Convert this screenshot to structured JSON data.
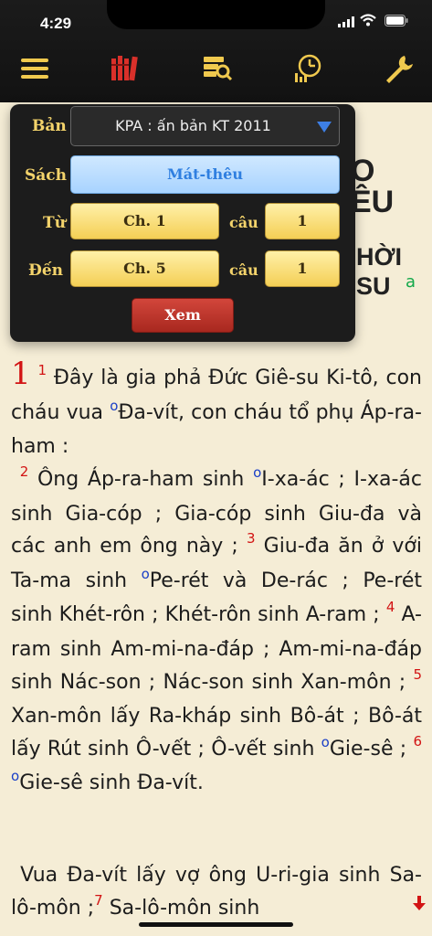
{
  "status": {
    "time": "4:29"
  },
  "toolbar": {
    "icons": [
      "menu-icon",
      "library-icon",
      "search-books-icon",
      "history-icon",
      "wrench-icon"
    ]
  },
  "background_title": {
    "line1": "O",
    "line2": "ÊU",
    "line3": "HỜI",
    "line4": "SU",
    "note": "a"
  },
  "popup": {
    "edition_label": "Bản",
    "edition_value": "KPA : ấn bản KT 2011",
    "book_label": "Sách",
    "book_value": "Mát-thêu",
    "from_label": "Từ",
    "from_chapter": "Ch. 1",
    "from_verse_label": "câu",
    "from_verse": "1",
    "to_label": "Đến",
    "to_chapter": "Ch. 5",
    "to_verse_label": "câu",
    "to_verse": "1",
    "view_button": "Xem"
  },
  "passage": {
    "chapter": "1",
    "p1": {
      "v1": "1",
      "t1": "Đây là gia phả Đức Giê-su Ki-tô, con cháu vua ",
      "ref1": "o",
      "t1b": "Đa-vít, con cháu tổ phụ Áp-ra-ham :"
    },
    "p2": {
      "v2": "2",
      "t2": "Ông Áp-ra-ham sinh ",
      "ref2": "o",
      "t2b": "I-xa-ác ; I-xa-ác sinh Gia-cóp ; Gia-cóp sinh Giu-đa và các anh em ông này ; ",
      "v3": "3",
      "t3": "Giu-đa ăn ở với Ta-ma sinh ",
      "ref3": "o",
      "t3b": "Pe-rét và De-rác ; Pe-rét sinh Khét-rôn ; Khét-rôn sinh A-ram ; ",
      "v4": "4",
      "t4": "A-ram sinh Am-mi-na-đáp ; Am-mi-na-đáp sinh Nác-son ; Nác-son sinh Xan-môn ; ",
      "v5": "5",
      "t5": "Xan-môn lấy Ra-kháp sinh Bô-át ; Bô-át lấy Rút sinh Ô-vết ; Ô-vết sinh ",
      "ref5": "o",
      "t5b": "Gie-sê ; ",
      "v6": "6",
      "ref6": "o",
      "t6": "Gie-sê sinh Đa-vít."
    },
    "p3": {
      "t6b": "Vua Đa-vít lấy vợ ông U-ri-gia sinh Sa-lô-môn ;",
      "v7": "7",
      "t7": "Sa-lô-môn sinh"
    }
  },
  "colors": {
    "verse_number": "#d21414",
    "reference_marker": "#1a3fc7",
    "label_gold": "#f3d36b"
  }
}
